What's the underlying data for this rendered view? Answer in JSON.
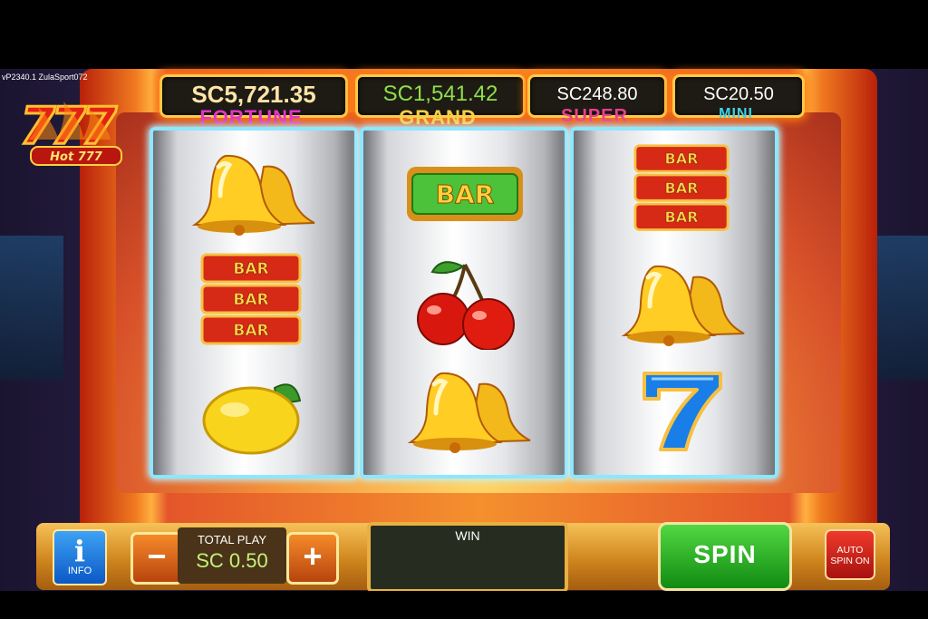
{
  "game": {
    "version": "vP2340.1 ZulaSport072",
    "logo": {
      "text": "Hot 777",
      "icon": "hot-777-logo"
    }
  },
  "jackpots": [
    {
      "name": "FORTUNE",
      "value": "SC5,721.35",
      "label_color": "#e035c8",
      "value_color": "#ffe4a8"
    },
    {
      "name": "GRAND",
      "value": "SC1,541.42",
      "label_color": "#f5d14a",
      "value_color": "#8fe04a"
    },
    {
      "name": "SUPER",
      "value": "SC248.80",
      "label_color": "#e8408c",
      "value_color": "#ffffff"
    },
    {
      "name": "MINI",
      "value": "SC20.50",
      "label_color": "#41d0e8",
      "value_color": "#ffffff"
    }
  ],
  "reels": [
    {
      "symbols": [
        "bells",
        "triple-bar",
        "lemon"
      ]
    },
    {
      "symbols": [
        "green-bar",
        "cherries",
        "bells"
      ]
    },
    {
      "symbols": [
        "triple-bar",
        "bells",
        "blue-seven"
      ]
    }
  ],
  "bar_text": "BAR",
  "controls": {
    "info_label": "INFO",
    "minus_label": "−",
    "plus_label": "+",
    "total_play_label": "TOTAL PLAY",
    "total_play_value": "SC 0.50",
    "win_label": "WIN",
    "spin_label": "SPIN",
    "auto_spin_label_1": "AUTO",
    "auto_spin_label_2": "SPIN ON"
  },
  "colors": {
    "cabinet": "#f07a20",
    "reel_glow": "#8ee6ff",
    "spin_green": "#2fb42a",
    "auto_red": "#d42418",
    "info_blue": "#1a78e0"
  }
}
